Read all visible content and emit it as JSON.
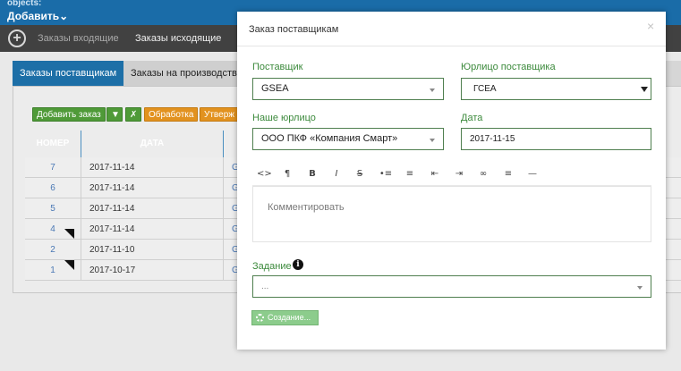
{
  "app": {
    "objects_label": "objects:",
    "add_label": "Добавить",
    "nav": {
      "incoming": "Заказы входящие",
      "outgoing": "Заказы исходящие"
    }
  },
  "tabs": [
    {
      "label": "Заказы поставщикам"
    },
    {
      "label": "Заказы на производство"
    }
  ],
  "toolbar": {
    "add_order": "Добавить заказ",
    "processing": "Обработка",
    "approve": "Утверж"
  },
  "grid": {
    "columns": [
      "НОМЕР",
      "ДАТА"
    ],
    "rows": [
      {
        "number": "7",
        "date": "2017-11-14",
        "extra": "G",
        "flag": false
      },
      {
        "number": "6",
        "date": "2017-11-14",
        "extra": "G",
        "flag": false
      },
      {
        "number": "5",
        "date": "2017-11-14",
        "extra": "G",
        "flag": false
      },
      {
        "number": "4",
        "date": "2017-11-14",
        "extra": "G",
        "flag": true
      },
      {
        "number": "2",
        "date": "2017-11-10",
        "extra": "G",
        "flag": false
      },
      {
        "number": "1",
        "date": "2017-10-17",
        "extra": "G",
        "flag": true
      }
    ]
  },
  "modal": {
    "title": "Заказ поставщикам",
    "close": "×",
    "supplier": {
      "label": "Поставщик",
      "value": "GSEA"
    },
    "supplier_legal": {
      "label": "Юрлицо поставщика",
      "value": "ГСЕА"
    },
    "our_legal": {
      "label": "Наше юрлицо",
      "value": "ООО ПКФ «Компания Смарт»"
    },
    "date": {
      "label": "Дата",
      "value": "2017-11-15"
    },
    "editor": {
      "tools": [
        "<>",
        "¶",
        "B",
        "I",
        "S",
        "ul",
        "ol",
        "out",
        "in",
        "link",
        "align",
        "hr"
      ],
      "placeholder": "Комментировать"
    },
    "task": {
      "label": "Задание",
      "value": "..."
    },
    "create_button": "Создание..."
  },
  "colors": {
    "brand_blue": "#1d6fa7",
    "field_green": "#4f7f4f",
    "label_green": "#3c8a3c",
    "button_green": "#8ccc8c"
  }
}
